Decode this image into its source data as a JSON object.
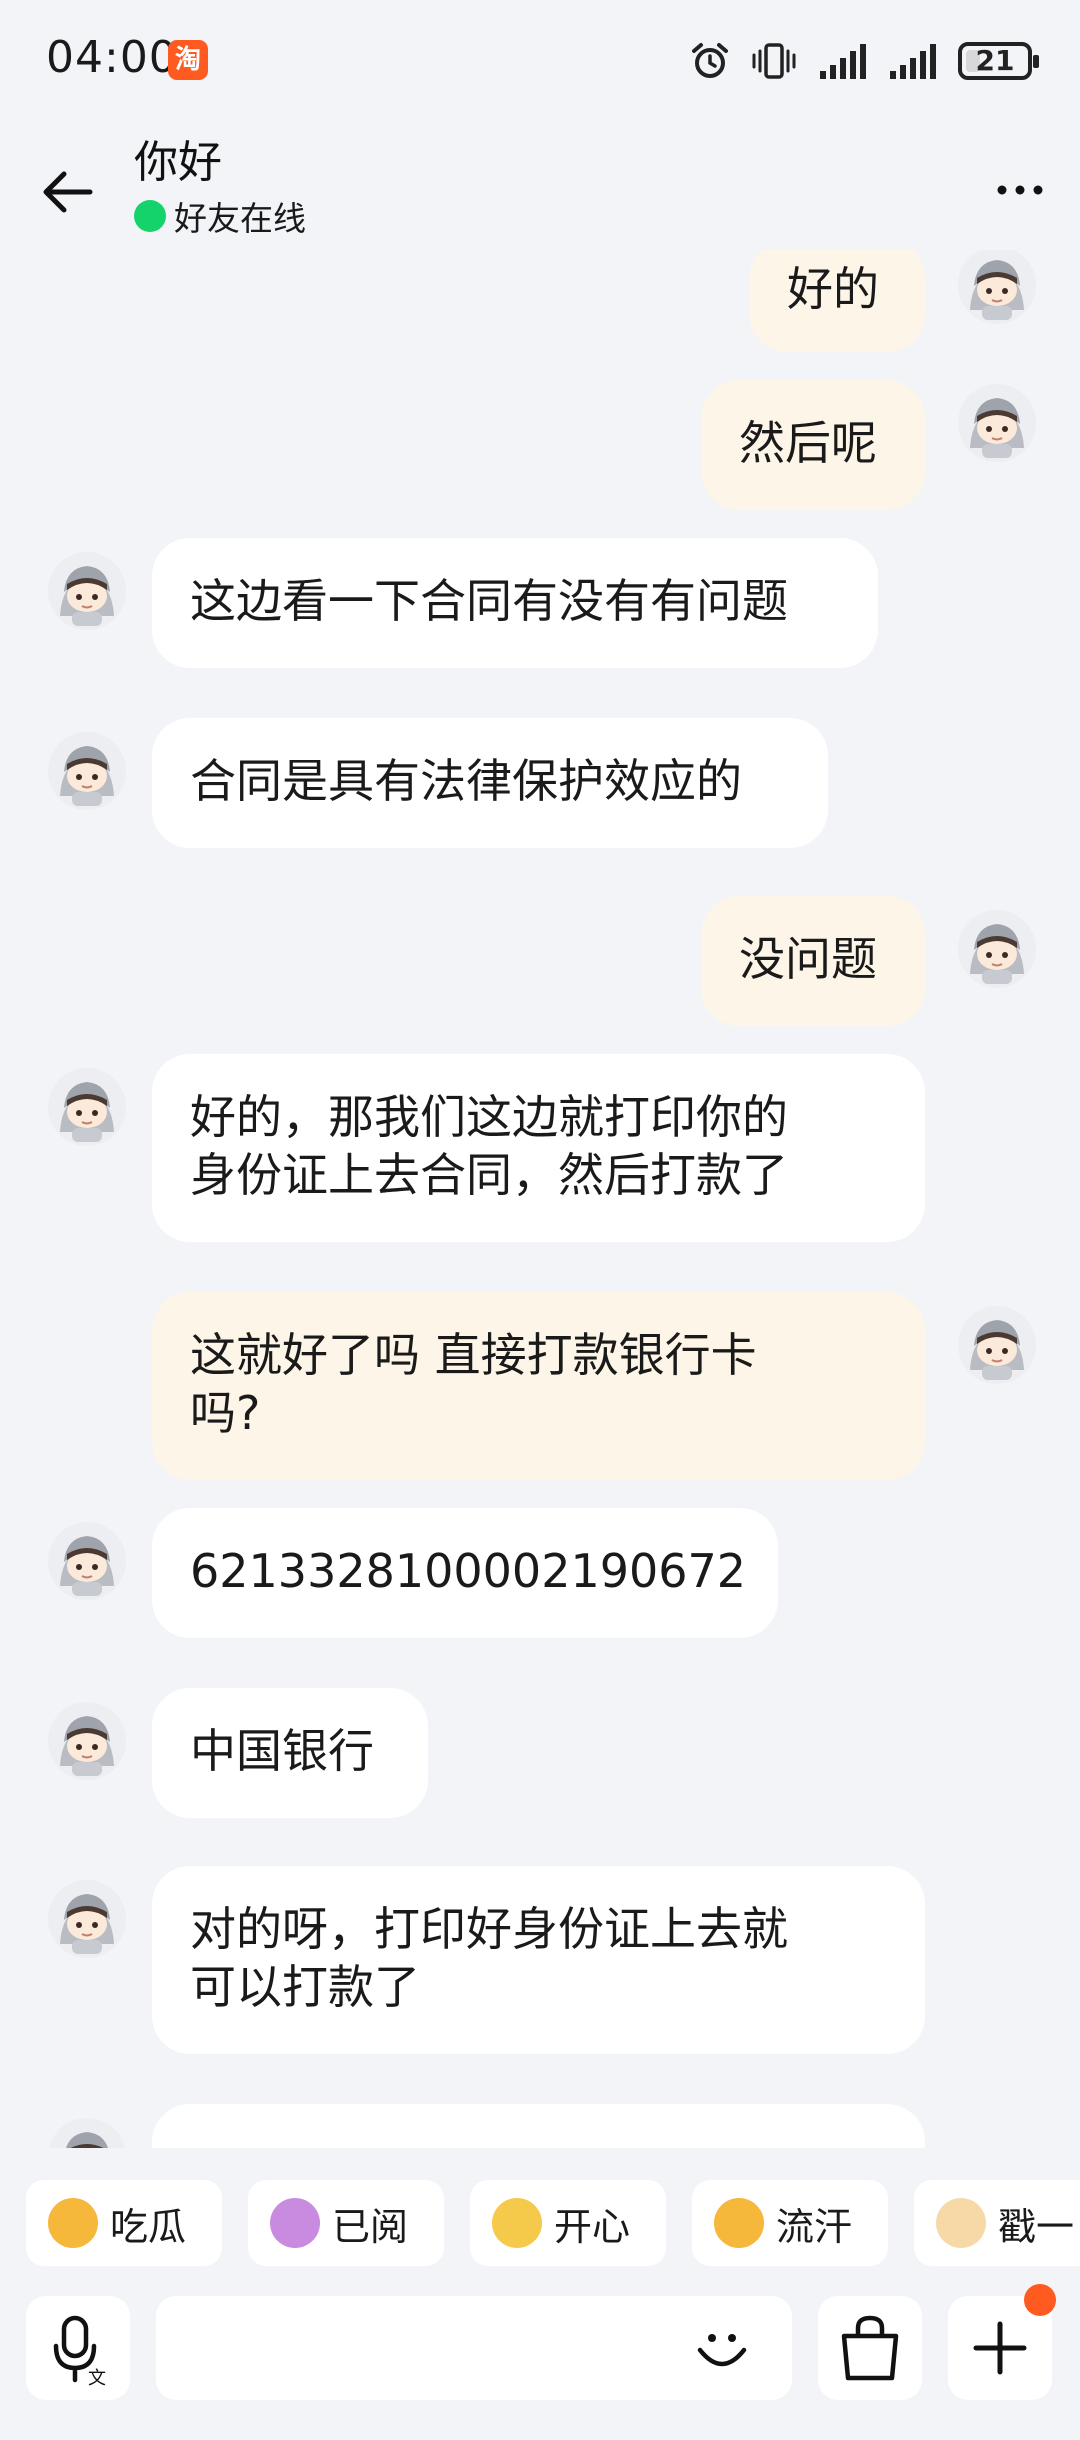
{
  "status_bar": {
    "time": "04:00",
    "app_icon_label": "淘",
    "battery_level": "21"
  },
  "header": {
    "title": "你好",
    "online_status": "好友在线",
    "back_icon": "arrow-left-icon",
    "more_icon": "more-dots-icon"
  },
  "messages": [
    {
      "side": "right",
      "text": "好的"
    },
    {
      "side": "right",
      "text": "然后呢"
    },
    {
      "side": "left",
      "text": "这边看一下合同有没有有问题"
    },
    {
      "side": "left",
      "text": "合同是具有法律保护效应的"
    },
    {
      "side": "right",
      "text": "没问题"
    },
    {
      "side": "left",
      "text": "好的，那我们这边就打印你的\n身份证上去合同，然后打款了"
    },
    {
      "side": "right",
      "text": "这就好了吗 直接打款银行卡\n吗?"
    },
    {
      "side": "left",
      "text": "6213328100002190672"
    },
    {
      "side": "left",
      "text": "中国银行"
    },
    {
      "side": "left",
      "text": "对的呀，打印好身份证上去就\n可以打款了"
    },
    {
      "side": "left",
      "text": ""
    }
  ],
  "quick_replies": [
    {
      "label": "吃瓜",
      "icon": "eating-melon-emoji"
    },
    {
      "label": "已阅",
      "icon": "read-emoji"
    },
    {
      "label": "开心",
      "icon": "happy-emoji"
    },
    {
      "label": "流汗",
      "icon": "sweat-emoji"
    },
    {
      "label": "戳一",
      "icon": "poke-emoji"
    }
  ],
  "input_bar": {
    "voice_icon": "voice-to-text-icon",
    "emoji_icon": "smile-icon",
    "bag_icon": "shopping-bag-icon",
    "plus_icon": "plus-icon"
  },
  "colors": {
    "background": "#f2f4f8",
    "incoming_bubble": "#ffffff",
    "outgoing_bubble": "#fdf6e8",
    "online": "#14d36a",
    "accent": "#ff5a1f"
  }
}
